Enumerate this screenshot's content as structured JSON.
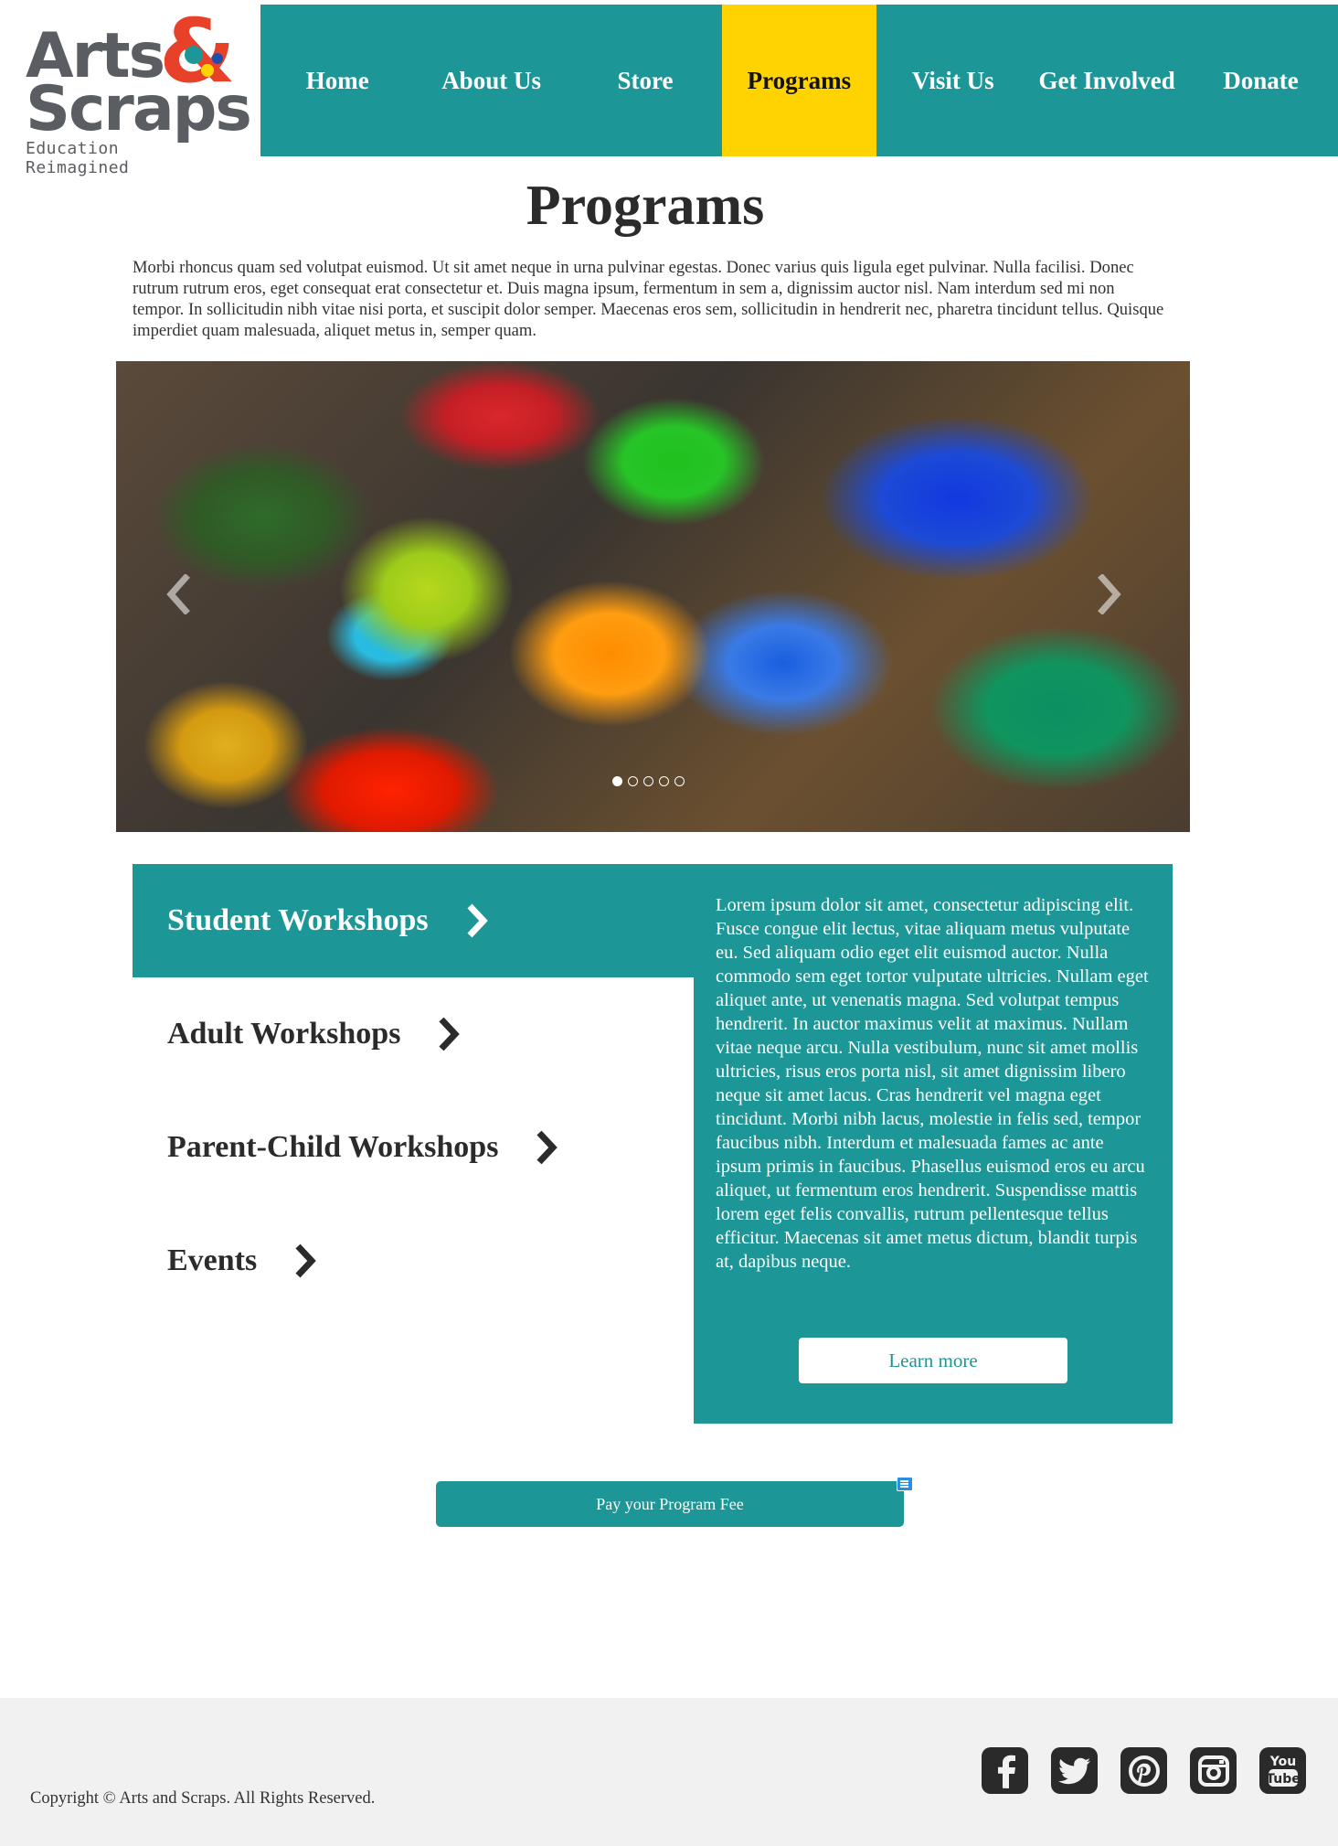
{
  "brand": {
    "name_line1": "Arts",
    "name_line2": "Scraps",
    "ampersand": "&",
    "tagline": "Education Reimagined"
  },
  "nav": {
    "items": [
      {
        "label": "Home"
      },
      {
        "label": "About Us"
      },
      {
        "label": "Store"
      },
      {
        "label": "Programs",
        "active": true
      },
      {
        "label": "Visit Us"
      },
      {
        "label": "Get Involved"
      },
      {
        "label": "Donate"
      }
    ]
  },
  "page": {
    "title": "Programs",
    "intro": "Morbi rhoncus quam sed volutpat euismod. Ut sit amet neque in urna pulvinar egestas. Donec varius quis ligula eget pulvinar. Nulla facilisi. Donec rutrum rutrum eros, eget consequat erat consectetur et. Duis magna ipsum, fermentum in sem a, dignissim auctor nisl. Nam interdum sed mi non tempor. In sollicitudin nibh vitae nisi porta, et suscipit dolor semper. Maecenas eros sem, sollicitudin in hendrerit nec, pharetra tincidunt tellus. Quisque imperdiet quam malesuada, aliquet metus in, semper quam."
  },
  "carousel": {
    "slide_count": 5,
    "active_index": 0
  },
  "programs": {
    "items": [
      {
        "label": "Student Workshops",
        "active": true
      },
      {
        "label": "Adult Workshops"
      },
      {
        "label": "Parent-Child Workshops"
      },
      {
        "label": "Events"
      }
    ],
    "detail_text": "Lorem ipsum dolor sit amet, consectetur adipiscing elit. Fusce congue elit lectus, vitae aliquam metus vulputate eu. Sed aliquam odio eget elit euismod auctor. Nulla commodo sem eget tortor vulputate ultricies. Nullam eget aliquet ante, ut venenatis magna. Sed volutpat tempus hendrerit. In auctor maximus velit at maximus. Nullam vitae neque arcu. Nulla vestibulum, nunc sit amet mollis ultricies, risus eros porta nisl, sit amet dignissim libero neque sit amet lacus. Cras hendrerit vel magna eget tincidunt. Morbi nibh lacus, molestie in felis sed, tempor faucibus nibh. Interdum et malesuada fames ac ante ipsum primis in faucibus. Phasellus euismod eros eu arcu aliquet, ut fermentum eros hendrerit. Suspendisse mattis lorem eget felis convallis, rutrum pellentesque tellus efficitur. Maecenas sit amet metus dictum, blandit turpis at, dapibus neque.",
    "learn_more_label": "Learn more"
  },
  "payment": {
    "button_label": "Pay your Program Fee"
  },
  "footer": {
    "copyright": "Copyright © Arts and Scraps. All Rights Reserved.",
    "social": [
      {
        "icon": "facebook-icon"
      },
      {
        "icon": "twitter-icon"
      },
      {
        "icon": "pinterest-icon"
      },
      {
        "icon": "instagram-icon"
      },
      {
        "icon": "youtube-icon",
        "text": "You Tube"
      }
    ]
  },
  "colors": {
    "teal": "#1d9697",
    "active_nav": "#ffd300",
    "footer_bg": "#f1f1f1",
    "icon_dark": "#2a2a2a"
  }
}
